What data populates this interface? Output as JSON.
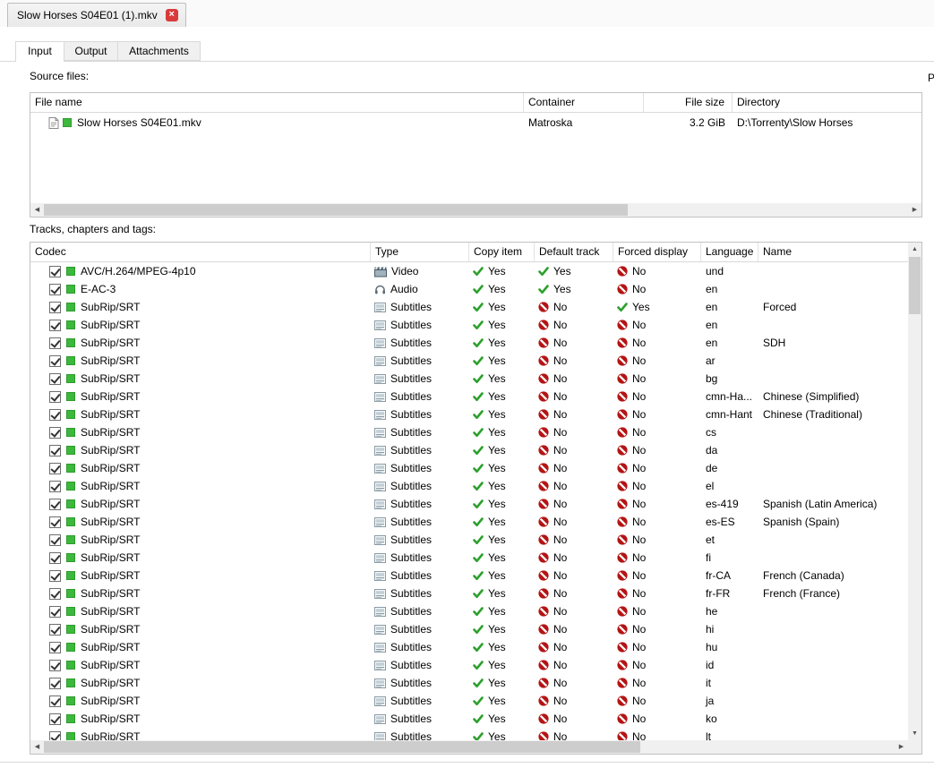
{
  "window_tab": {
    "title": "Slow Horses S04E01 (1).mkv",
    "close_label": "×"
  },
  "section_tabs": [
    {
      "label": "Input"
    },
    {
      "label": "Output"
    },
    {
      "label": "Attachments"
    }
  ],
  "active_section_tab": "Input",
  "clipped_right_text": "P",
  "colors": {
    "yes_green": "#2ca02c",
    "no_red": "#b41414",
    "enabled_green": "#3cb83c",
    "close_red": "#d93b3b"
  },
  "source_files": {
    "label": "Source files:",
    "columns": [
      "File name",
      "Container",
      "File size",
      "Directory"
    ],
    "rows": [
      {
        "file_name": "Slow Horses S04E01.mkv",
        "container": "Matroska",
        "file_size": "3.2 GiB",
        "directory": "D:\\Torrenty\\Slow Horses"
      }
    ]
  },
  "tracks": {
    "label": "Tracks, chapters and tags:",
    "columns": [
      "Codec",
      "Type",
      "Copy item",
      "Default track",
      "Forced display",
      "Language",
      "Name"
    ],
    "rows": [
      {
        "checked": true,
        "codec": "AVC/H.264/MPEG-4p10",
        "type": "Video",
        "copy_item": "Yes",
        "default_track": "Yes",
        "forced_display": "No",
        "language": "und",
        "name": ""
      },
      {
        "checked": true,
        "codec": "E-AC-3",
        "type": "Audio",
        "copy_item": "Yes",
        "default_track": "Yes",
        "forced_display": "No",
        "language": "en",
        "name": ""
      },
      {
        "checked": true,
        "codec": "SubRip/SRT",
        "type": "Subtitles",
        "copy_item": "Yes",
        "default_track": "No",
        "forced_display": "Yes",
        "language": "en",
        "name": "Forced"
      },
      {
        "checked": true,
        "codec": "SubRip/SRT",
        "type": "Subtitles",
        "copy_item": "Yes",
        "default_track": "No",
        "forced_display": "No",
        "language": "en",
        "name": ""
      },
      {
        "checked": true,
        "codec": "SubRip/SRT",
        "type": "Subtitles",
        "copy_item": "Yes",
        "default_track": "No",
        "forced_display": "No",
        "language": "en",
        "name": "SDH"
      },
      {
        "checked": true,
        "codec": "SubRip/SRT",
        "type": "Subtitles",
        "copy_item": "Yes",
        "default_track": "No",
        "forced_display": "No",
        "language": "ar",
        "name": ""
      },
      {
        "checked": true,
        "codec": "SubRip/SRT",
        "type": "Subtitles",
        "copy_item": "Yes",
        "default_track": "No",
        "forced_display": "No",
        "language": "bg",
        "name": ""
      },
      {
        "checked": true,
        "codec": "SubRip/SRT",
        "type": "Subtitles",
        "copy_item": "Yes",
        "default_track": "No",
        "forced_display": "No",
        "language": "cmn-Ha...",
        "name": "Chinese (Simplified)"
      },
      {
        "checked": true,
        "codec": "SubRip/SRT",
        "type": "Subtitles",
        "copy_item": "Yes",
        "default_track": "No",
        "forced_display": "No",
        "language": "cmn-Hant",
        "name": "Chinese (Traditional)"
      },
      {
        "checked": true,
        "codec": "SubRip/SRT",
        "type": "Subtitles",
        "copy_item": "Yes",
        "default_track": "No",
        "forced_display": "No",
        "language": "cs",
        "name": ""
      },
      {
        "checked": true,
        "codec": "SubRip/SRT",
        "type": "Subtitles",
        "copy_item": "Yes",
        "default_track": "No",
        "forced_display": "No",
        "language": "da",
        "name": ""
      },
      {
        "checked": true,
        "codec": "SubRip/SRT",
        "type": "Subtitles",
        "copy_item": "Yes",
        "default_track": "No",
        "forced_display": "No",
        "language": "de",
        "name": ""
      },
      {
        "checked": true,
        "codec": "SubRip/SRT",
        "type": "Subtitles",
        "copy_item": "Yes",
        "default_track": "No",
        "forced_display": "No",
        "language": "el",
        "name": ""
      },
      {
        "checked": true,
        "codec": "SubRip/SRT",
        "type": "Subtitles",
        "copy_item": "Yes",
        "default_track": "No",
        "forced_display": "No",
        "language": "es-419",
        "name": "Spanish (Latin America)"
      },
      {
        "checked": true,
        "codec": "SubRip/SRT",
        "type": "Subtitles",
        "copy_item": "Yes",
        "default_track": "No",
        "forced_display": "No",
        "language": "es-ES",
        "name": "Spanish (Spain)"
      },
      {
        "checked": true,
        "codec": "SubRip/SRT",
        "type": "Subtitles",
        "copy_item": "Yes",
        "default_track": "No",
        "forced_display": "No",
        "language": "et",
        "name": ""
      },
      {
        "checked": true,
        "codec": "SubRip/SRT",
        "type": "Subtitles",
        "copy_item": "Yes",
        "default_track": "No",
        "forced_display": "No",
        "language": "fi",
        "name": ""
      },
      {
        "checked": true,
        "codec": "SubRip/SRT",
        "type": "Subtitles",
        "copy_item": "Yes",
        "default_track": "No",
        "forced_display": "No",
        "language": "fr-CA",
        "name": "French (Canada)"
      },
      {
        "checked": true,
        "codec": "SubRip/SRT",
        "type": "Subtitles",
        "copy_item": "Yes",
        "default_track": "No",
        "forced_display": "No",
        "language": "fr-FR",
        "name": "French (France)"
      },
      {
        "checked": true,
        "codec": "SubRip/SRT",
        "type": "Subtitles",
        "copy_item": "Yes",
        "default_track": "No",
        "forced_display": "No",
        "language": "he",
        "name": ""
      },
      {
        "checked": true,
        "codec": "SubRip/SRT",
        "type": "Subtitles",
        "copy_item": "Yes",
        "default_track": "No",
        "forced_display": "No",
        "language": "hi",
        "name": ""
      },
      {
        "checked": true,
        "codec": "SubRip/SRT",
        "type": "Subtitles",
        "copy_item": "Yes",
        "default_track": "No",
        "forced_display": "No",
        "language": "hu",
        "name": ""
      },
      {
        "checked": true,
        "codec": "SubRip/SRT",
        "type": "Subtitles",
        "copy_item": "Yes",
        "default_track": "No",
        "forced_display": "No",
        "language": "id",
        "name": ""
      },
      {
        "checked": true,
        "codec": "SubRip/SRT",
        "type": "Subtitles",
        "copy_item": "Yes",
        "default_track": "No",
        "forced_display": "No",
        "language": "it",
        "name": ""
      },
      {
        "checked": true,
        "codec": "SubRip/SRT",
        "type": "Subtitles",
        "copy_item": "Yes",
        "default_track": "No",
        "forced_display": "No",
        "language": "ja",
        "name": ""
      },
      {
        "checked": true,
        "codec": "SubRip/SRT",
        "type": "Subtitles",
        "copy_item": "Yes",
        "default_track": "No",
        "forced_display": "No",
        "language": "ko",
        "name": ""
      },
      {
        "checked": true,
        "codec": "SubRip/SRT",
        "type": "Subtitles",
        "copy_item": "Yes",
        "default_track": "No",
        "forced_display": "No",
        "language": "lt",
        "name": ""
      }
    ]
  }
}
